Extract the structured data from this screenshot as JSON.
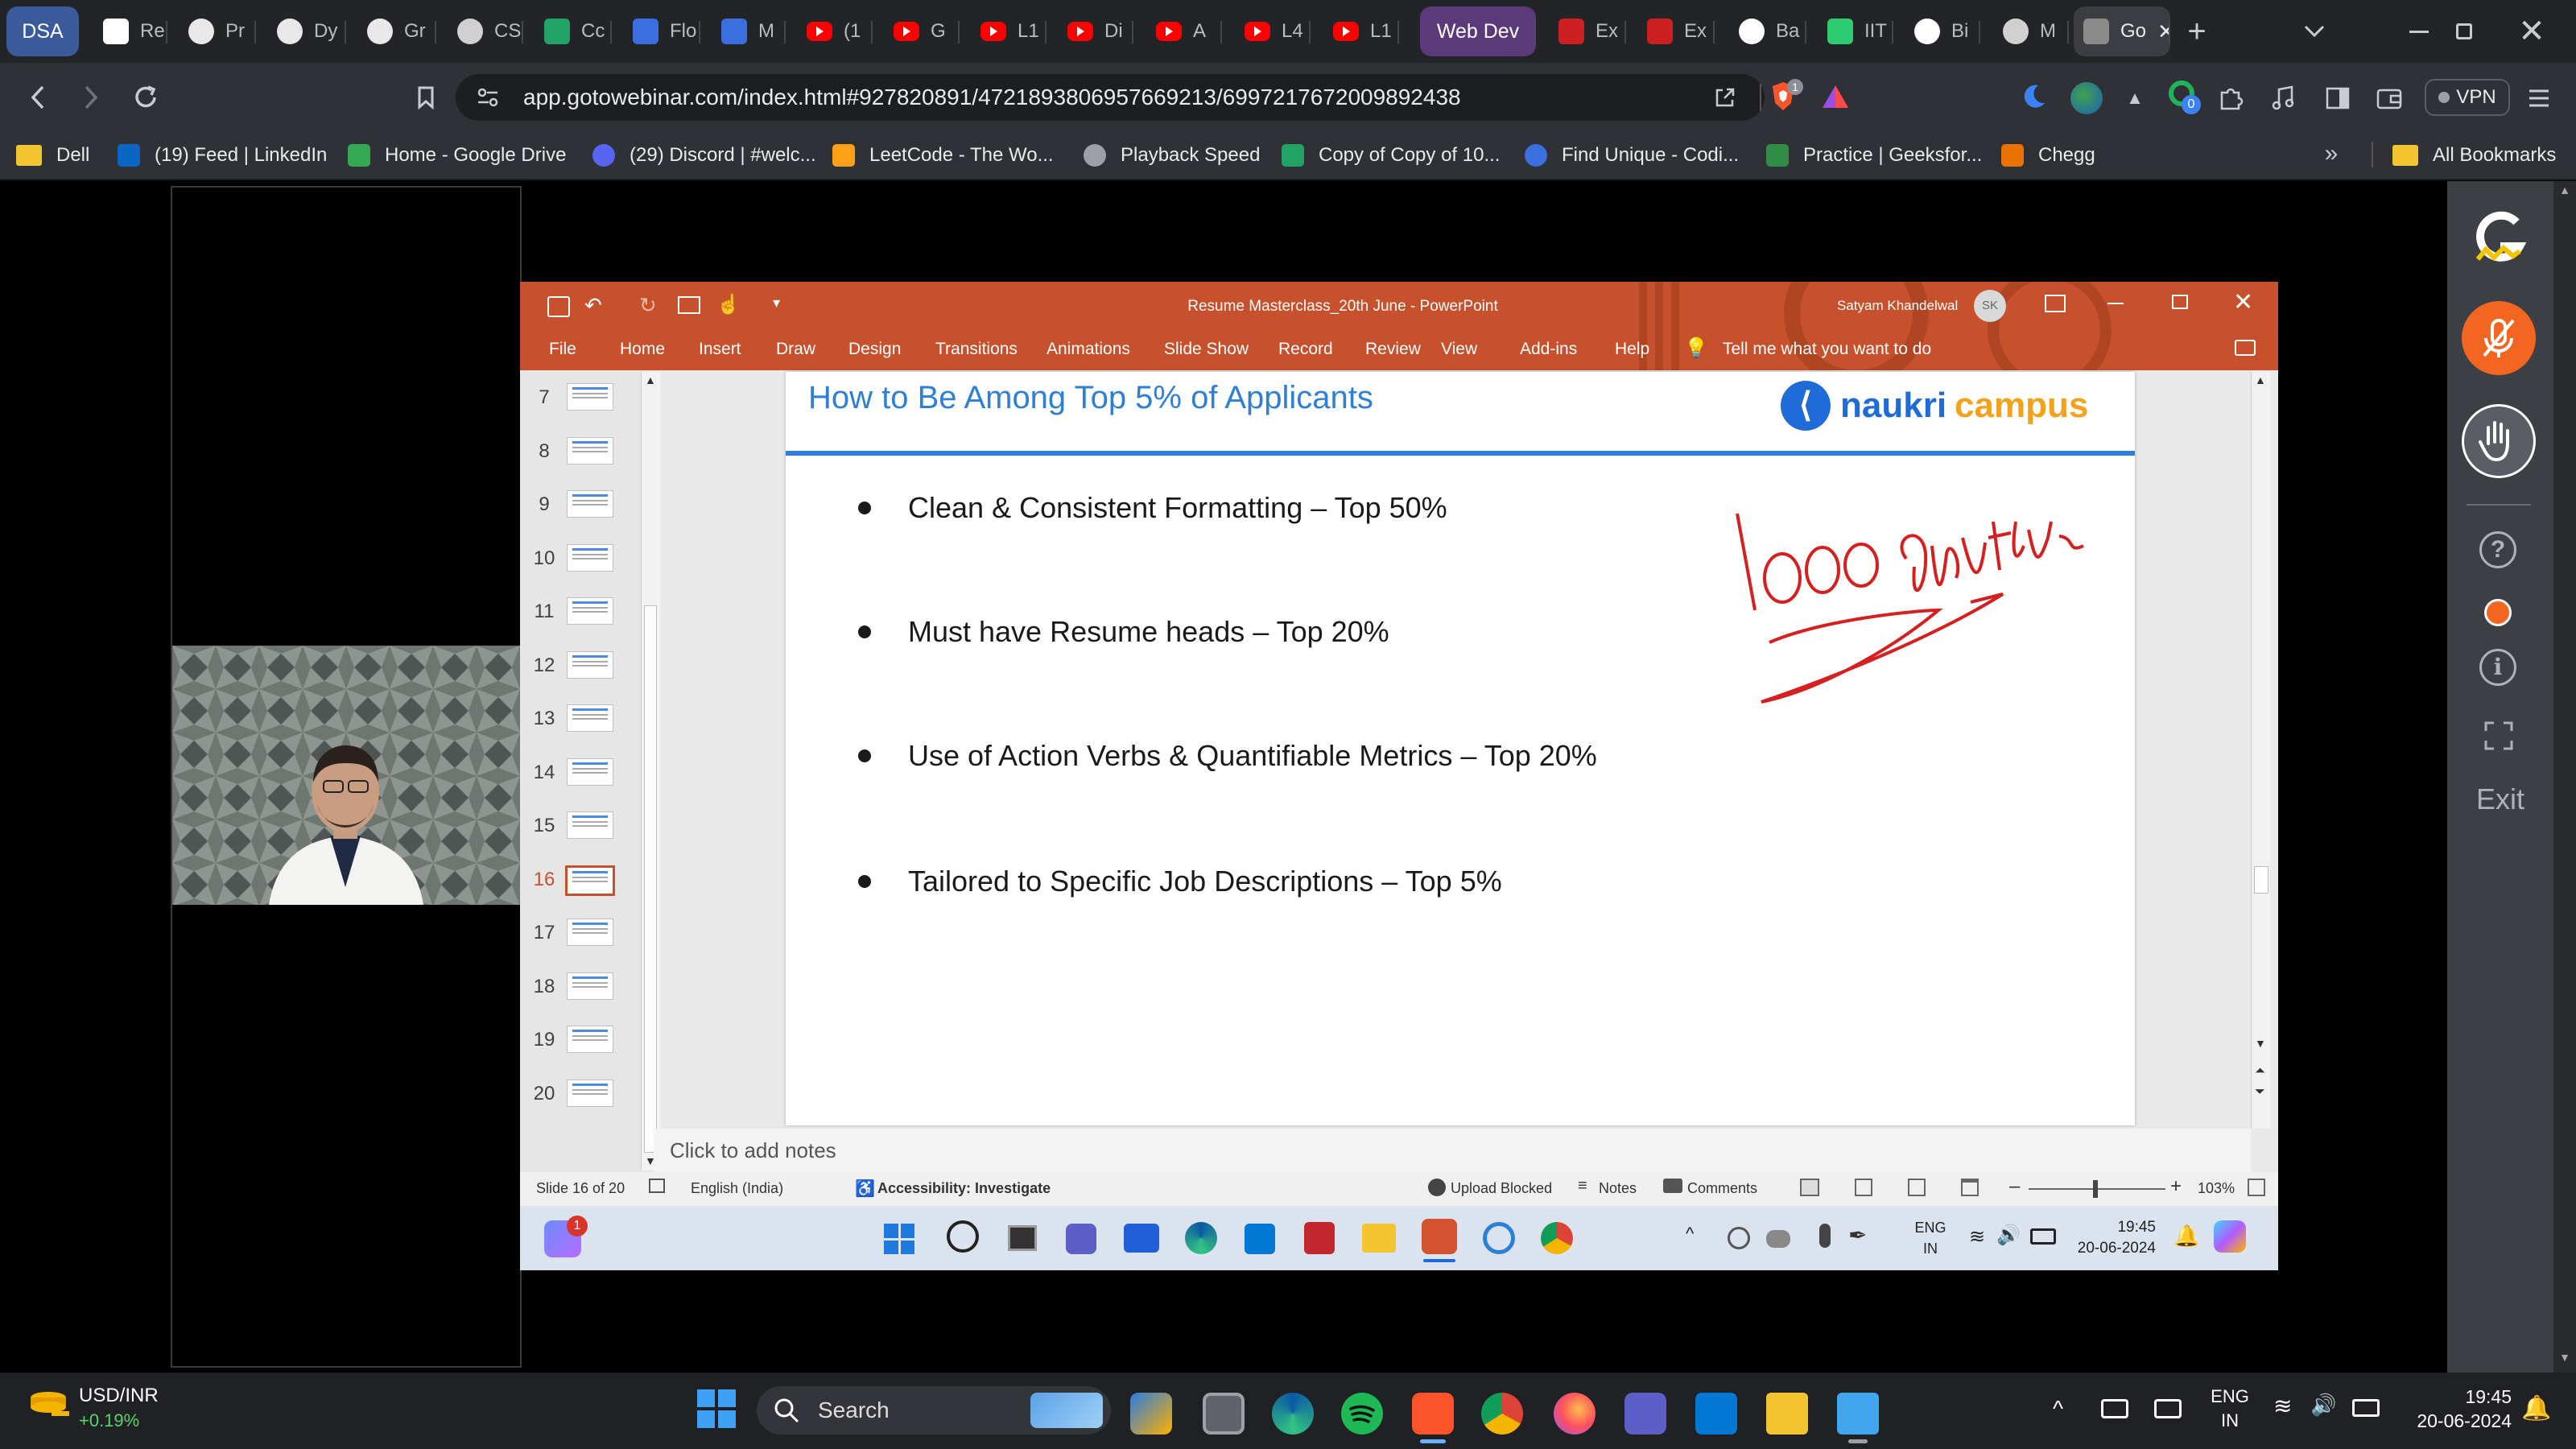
{
  "browser": {
    "tabs": [
      {
        "label": "DSA",
        "color": "#3a5a9c",
        "icon": "group-chip"
      },
      {
        "label": "Re",
        "color": "#ffffff",
        "icon": "r-logo"
      },
      {
        "label": "Pr",
        "color": "#e8e8e8",
        "icon": "mountain-logo"
      },
      {
        "label": "Dy",
        "color": "#e8e8e8",
        "icon": "mountain-logo"
      },
      {
        "label": "Gr",
        "color": "#e8e8e8",
        "icon": "mountain-logo"
      },
      {
        "label": "CS",
        "color": "#d0d0d0",
        "icon": "globe-logo"
      },
      {
        "label": "Cc",
        "color": "#21a366",
        "icon": "sheets-logo"
      },
      {
        "label": "Flo",
        "color": "#3b6fe0",
        "icon": "k-logo"
      },
      {
        "label": "M",
        "color": "#3b6fe0",
        "icon": "k-logo"
      },
      {
        "label": "(1",
        "color": "#ff0000",
        "icon": "youtube-logo"
      },
      {
        "label": "G",
        "color": "#ff0000",
        "icon": "youtube-logo"
      },
      {
        "label": "L1",
        "color": "#ff0000",
        "icon": "youtube-logo"
      },
      {
        "label": "Di",
        "color": "#ff0000",
        "icon": "youtube-logo"
      },
      {
        "label": "A",
        "color": "#ff0000",
        "icon": "youtube-logo"
      },
      {
        "label": "L4",
        "color": "#ff0000",
        "icon": "youtube-logo"
      },
      {
        "label": "L1",
        "color": "#ff0000",
        "icon": "youtube-logo"
      },
      {
        "label": "Web Dev",
        "color": "#5c3a7a",
        "icon": "group-chip"
      },
      {
        "label": "Ex",
        "color": "#cc1f1f",
        "icon": "excel-logo"
      },
      {
        "label": "Ex",
        "color": "#cc1f1f",
        "icon": "excel-logo"
      },
      {
        "label": "Ba",
        "color": "#ffffff",
        "icon": "github-logo"
      },
      {
        "label": "IIT",
        "color": "#2ecc71",
        "icon": "leaf-logo"
      },
      {
        "label": "Bi",
        "color": "#ffffff",
        "icon": "openai-logo"
      },
      {
        "label": "M",
        "color": "#d0d0d0",
        "icon": "globe-logo"
      },
      {
        "label": "Go",
        "color": "#8a8a8a",
        "icon": "gotowebinar-logo"
      }
    ],
    "new_tab_label": "+",
    "url": "app.gotowebinar.com/index.html#927820891/4721893806957669213/6997217672009892438",
    "brave_badge": "1",
    "extension_badge": "0",
    "vpn_label": "VPN",
    "bookmarks": [
      {
        "label": "Dell",
        "icon": "folder-icon",
        "color": "#f4c430"
      },
      {
        "label": "(19) Feed | LinkedIn",
        "icon": "linkedin-icon",
        "color": "#0a66c2"
      },
      {
        "label": "Home - Google Drive",
        "icon": "drive-icon",
        "color": "#34a853"
      },
      {
        "label": "(29) Discord | #welc...",
        "icon": "discord-icon",
        "color": "#5865f2"
      },
      {
        "label": "LeetCode - The Wo...",
        "icon": "leetcode-icon",
        "color": "#ffa116"
      },
      {
        "label": "Playback Speed",
        "icon": "globe-icon",
        "color": "#9aa0a6"
      },
      {
        "label": "Copy of Copy of 10...",
        "icon": "sheets-icon",
        "color": "#21a366"
      },
      {
        "label": "Find Unique - Codi...",
        "icon": "codingninja-icon",
        "color": "#3b6fe0"
      },
      {
        "label": "Practice | Geeksfor...",
        "icon": "gfg-icon",
        "color": "#2f8d46"
      },
      {
        "label": "Chegg",
        "icon": "chegg-icon",
        "color": "#eb7100"
      }
    ],
    "all_bookmarks_label": "All Bookmarks"
  },
  "webinar": {
    "exit_label": "Exit"
  },
  "powerpoint": {
    "title": "Resume Masterclass_20th June  -  PowerPoint",
    "user_name": "Satyam Khandelwal",
    "user_initials": "SK",
    "ribbon": [
      "File",
      "Home",
      "Insert",
      "Draw",
      "Design",
      "Transitions",
      "Animations",
      "Slide Show",
      "Record",
      "Review",
      "View",
      "Add-ins",
      "Help"
    ],
    "tell_me": "Tell me what you want to do",
    "thumbnail_numbers": [
      "7",
      "8",
      "9",
      "10",
      "11",
      "12",
      "13",
      "14",
      "15",
      "16",
      "17",
      "18",
      "19",
      "20"
    ],
    "active_slide_number": "16",
    "slide": {
      "title": "How to Be Among Top 5% of Applicants",
      "logo_word1": "naukri",
      "logo_word2": "campus",
      "bullets": [
        "Clean & Consistent Formatting – Top 50%",
        "Must have Resume heads – Top 20%",
        "Use of Action Verbs & Quantifiable Metrics – Top 20%",
        "Tailored to Specific Job Descriptions – Top 5%"
      ],
      "handwritten_note": "1000 Applicants"
    },
    "notes_placeholder": "Click to add notes",
    "status": {
      "slide_counter": "Slide 16 of 20",
      "language": "English (India)",
      "accessibility": "Accessibility: Investigate",
      "upload": "Upload Blocked",
      "notes": "Notes",
      "comments": "Comments",
      "zoom": "103%"
    },
    "inner_taskbar": {
      "lang_top": "ENG",
      "lang_bottom": "IN",
      "time": "19:45",
      "date": "20-06-2024",
      "notif_badge": "1"
    }
  },
  "taskbar": {
    "ticker_name": "USD/INR",
    "ticker_change": "+0.19%",
    "search_placeholder": "Search",
    "lang_top": "ENG",
    "lang_bottom": "IN",
    "time": "19:45",
    "date": "20-06-2024"
  }
}
